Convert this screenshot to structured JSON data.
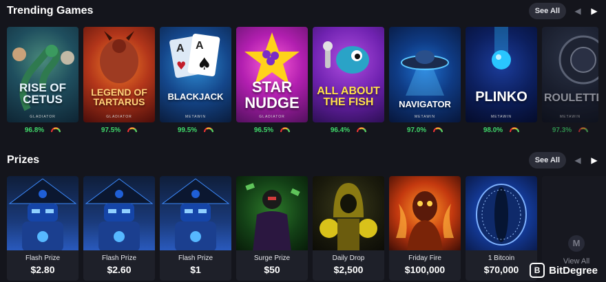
{
  "trending": {
    "title": "Trending Games",
    "see_all": "See All",
    "prev_icon": "arrow-left-icon",
    "next_icon": "arrow-right-icon",
    "games": [
      {
        "name": "RISE OF CETUS",
        "studio": "GLADIATOR",
        "rtp": "96.8%",
        "gauge_level": 0.55
      },
      {
        "name": "LEGEND OF TARTARUS",
        "studio": "GLADIATOR",
        "rtp": "97.5%",
        "gauge_level": 0.6
      },
      {
        "name": "BLACKJACK",
        "studio": "METAWIN",
        "rtp": "99.5%",
        "gauge_level": 0.75
      },
      {
        "name": "STAR NUDGE",
        "studio": "GLADIATOR",
        "rtp": "96.5%",
        "gauge_level": 0.5
      },
      {
        "name": "ALL ABOUT THE FISH",
        "studio": "",
        "rtp": "96.4%",
        "gauge_level": 0.5
      },
      {
        "name": "NAVIGATOR",
        "studio": "METAWIN",
        "rtp": "97.0%",
        "gauge_level": 0.6
      },
      {
        "name": "PLINKO",
        "studio": "METAWIN",
        "rtp": "98.0%",
        "gauge_level": 0.7
      },
      {
        "name": "ROULETTE",
        "studio": "METAWIN",
        "rtp": "97.3%",
        "gauge_level": 0.6
      }
    ]
  },
  "prizes": {
    "title": "Prizes",
    "see_all": "See All",
    "items": [
      {
        "name": "Flash Prize",
        "amount": "$2.80"
      },
      {
        "name": "Flash Prize",
        "amount": "$2.60"
      },
      {
        "name": "Flash Prize",
        "amount": "$1"
      },
      {
        "name": "Surge Prize",
        "amount": "$50"
      },
      {
        "name": "Daily Drop",
        "amount": "$2,500"
      },
      {
        "name": "Friday Fire",
        "amount": "$100,000"
      },
      {
        "name": "1 Bitcoin",
        "amount": "$70,000"
      }
    ],
    "view_all": "View All"
  },
  "watermark": {
    "brand": "BitDegree"
  },
  "colors": {
    "background": "#14151c",
    "rtp_green": "#40d96b",
    "pill": "#2b2d38",
    "card_footer": "#1e2029"
  }
}
